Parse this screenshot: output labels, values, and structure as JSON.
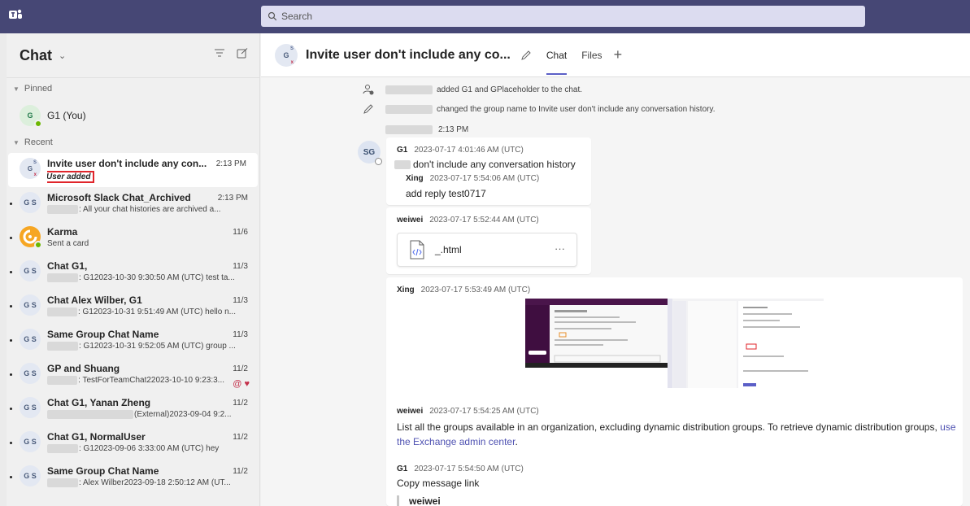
{
  "app": {
    "search_placeholder": "Search"
  },
  "sidebar": {
    "title": "Chat",
    "pinned_label": "Pinned",
    "recent_label": "Recent",
    "pinned": [
      {
        "initials": "G",
        "name": "G1 (You)"
      }
    ],
    "chats": [
      {
        "initials": "G",
        "title": "Invite user don't include any con...",
        "preview": "User added",
        "time": "2:13 PM",
        "active": true
      },
      {
        "initials": "G S",
        "title": "Microsoft Slack Chat_Archived",
        "preview": ": All your chat histories are archived a...",
        "time": "2:13 PM"
      },
      {
        "initials": "",
        "title": "Karma",
        "preview": "Sent a card",
        "time": "11/6"
      },
      {
        "initials": "G S",
        "title": "Chat G1,",
        "preview": ": G12023-10-30 9:30:50 AM (UTC) test ta...",
        "time": "11/3"
      },
      {
        "initials": "G S",
        "title": "Chat Alex Wilber, G1",
        "preview": ": G12023-10-31 9:51:49 AM (UTC) hello n...",
        "time": "11/3"
      },
      {
        "initials": "G S",
        "title": "Same Group Chat Name",
        "preview": ": G12023-10-31 9:52:05 AM (UTC) group ...",
        "time": "11/3"
      },
      {
        "initials": "G S",
        "title": "GP and Shuang",
        "preview": ": TestForTeamChat22023-10-10 9:23:3...",
        "time": "11/2"
      },
      {
        "initials": "G S",
        "title": "Chat G1, Yanan Zheng",
        "preview": "(External)2023-09-04 9:2...",
        "time": "11/2"
      },
      {
        "initials": "G S",
        "title": "Chat G1, NormalUser",
        "preview": ": G12023-09-06 3:33:00 AM (UTC) hey",
        "time": "11/2"
      },
      {
        "initials": "G S",
        "title": "Same Group Chat Name",
        "preview": ": Alex Wilber2023-09-18 2:50:12 AM (UT...",
        "time": "11/2"
      }
    ]
  },
  "main": {
    "title": "Invite user don't include any co...",
    "tabs": [
      "Chat",
      "Files"
    ],
    "system": {
      "added": "added G1 and GPlaceholder to the chat.",
      "renamed": "changed the group name to Invite user don't include any conversation history.",
      "time": "2:13 PM"
    },
    "sender_initials": "SG",
    "messages": {
      "m1": {
        "author": "G1",
        "time": "2023-07-17 4:01:46 AM (UTC)",
        "body": "don't include any conversation history",
        "reply_author": "Xing",
        "reply_time": "2023-07-17 5:54:06 AM (UTC)",
        "reply_body": "add reply test0717"
      },
      "m2": {
        "author": "weiwei",
        "time": "2023-07-17 5:52:44 AM (UTC)",
        "file": "_.html"
      },
      "m3": {
        "author": "Xing",
        "time": "2023-07-17 5:53:49 AM (UTC)"
      },
      "m4": {
        "author": "weiwei",
        "time": "2023-07-17 5:54:25 AM (UTC)",
        "body": "List all the groups available in an organization, excluding dynamic distribution groups. To retrieve dynamic distribution groups,",
        "link": "use the Exchange admin center",
        "link_tail": "."
      },
      "m5": {
        "author": "G1",
        "time": "2023-07-17 5:54:50 AM (UTC)",
        "body": "Copy message link",
        "quote": "weiwei"
      }
    }
  },
  "colors": {
    "topbar": "#464775",
    "accent": "#5b5fc7",
    "highlight_box": "#e0252b",
    "presence": "#6bb700"
  }
}
